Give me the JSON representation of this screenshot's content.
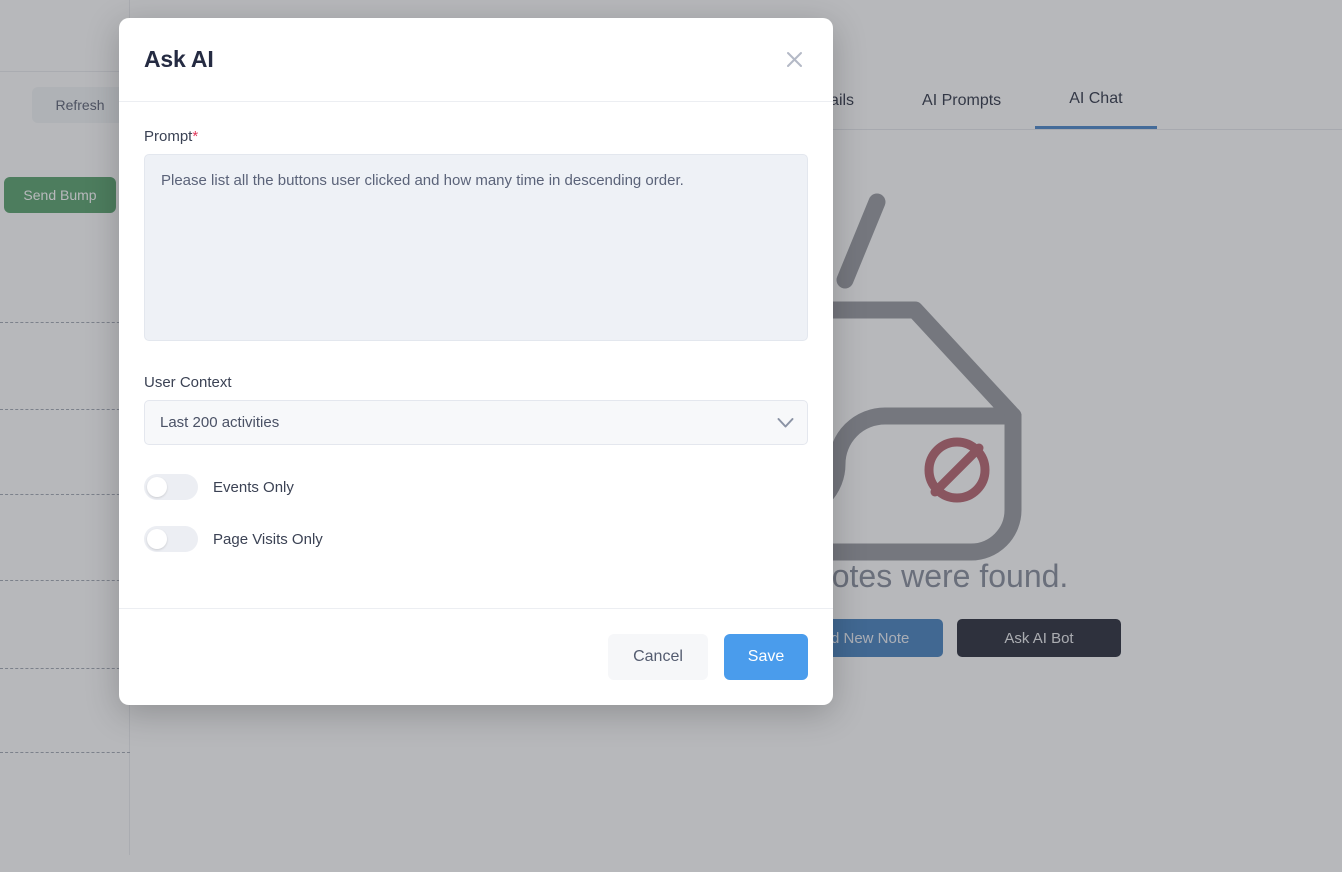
{
  "background": {
    "toolbar": {
      "refresh_label": "Refresh",
      "send_bump_label": "Send Bump"
    },
    "tabs": [
      {
        "label": "ssosiated Emails",
        "active": false
      },
      {
        "label": "AI Prompts",
        "active": false
      },
      {
        "label": "AI Chat",
        "active": true
      }
    ],
    "empty_state": {
      "message": "otes were found.",
      "illustration": "empty-tray-icon"
    },
    "actions": {
      "add_note_label": "Add New Note",
      "ask_ai_bot_label": "Ask AI Bot"
    },
    "colors": {
      "send_bump_green": "#499a5f",
      "add_note_blue": "#3576b8",
      "ask_bot_dark": "#131726",
      "active_tab_underline": "#3a7bc4",
      "empty_text": "#7b8192"
    }
  },
  "modal": {
    "title": "Ask AI",
    "close_icon": "close-icon",
    "prompt": {
      "label": "Prompt",
      "required_marker": "*",
      "value": "Please list all the buttons user clicked and how many time in descending order.",
      "placeholder": "Please list all the buttons user clicked and how many time in descending order."
    },
    "user_context": {
      "label": "User Context",
      "selected": "Last 200 activities",
      "options": [
        "Last 200 activities"
      ],
      "chevron_icon": "chevron-down-icon"
    },
    "toggles": [
      {
        "label": "Events Only",
        "on": false
      },
      {
        "label": "Page Visits Only",
        "on": false
      }
    ],
    "footer": {
      "cancel_label": "Cancel",
      "save_label": "Save"
    },
    "colors": {
      "save_blue": "#4a9cec",
      "cancel_gray": "#f6f7f9",
      "required_red": "#e0395b",
      "title_dark": "#252b42"
    }
  }
}
